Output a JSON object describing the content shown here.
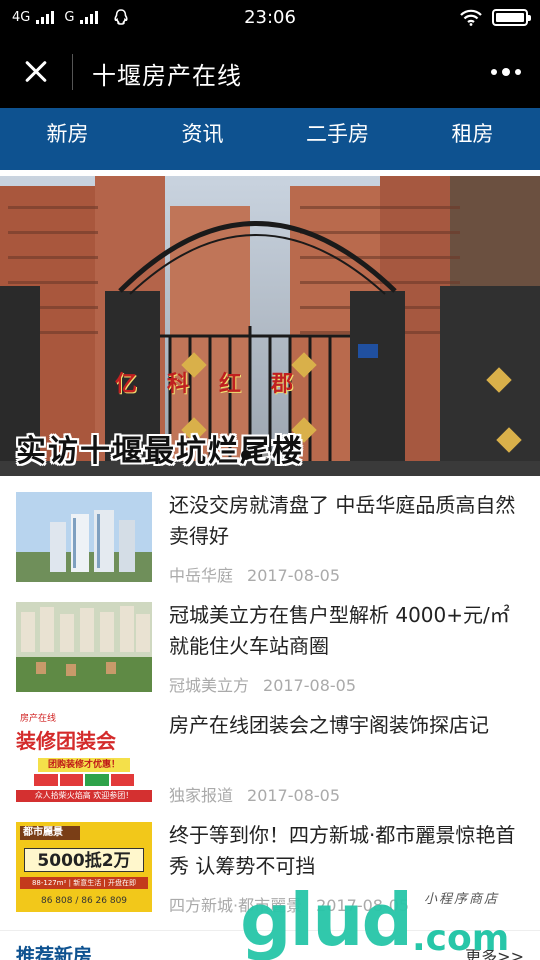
{
  "status_bar": {
    "carrier_1": "4G",
    "carrier_2": "G",
    "time": "23:06",
    "icons": [
      "signal-icon",
      "signal-icon",
      "qq-penguin-icon",
      "wifi-icon",
      "battery-icon"
    ]
  },
  "title_bar": {
    "title": "十堰房产在线",
    "close_icon": "close-icon",
    "more_icon": "more-icon"
  },
  "nav": {
    "items": [
      {
        "label": "新房"
      },
      {
        "label": "资讯"
      },
      {
        "label": "二手房"
      },
      {
        "label": "租房"
      }
    ],
    "color": "#0e5290"
  },
  "banner": {
    "caption": "实访十堰最坑烂尾楼",
    "arch_text": "亿科红郡",
    "slide_count": 2,
    "active_slide": 1
  },
  "news": [
    {
      "title": "还没交房就清盘了 中岳华庭品质高自然卖得好",
      "source": "中岳华庭",
      "date": "2017-08-05"
    },
    {
      "title": "冠城美立方在售户型解析 4000+元/㎡就能住火车站商圈",
      "source": "冠城美立方",
      "date": "2017-08-05"
    },
    {
      "title": "房产在线团装会之博宇阁装饰探店记",
      "source": "独家报道",
      "date": "2017-08-05"
    },
    {
      "title": "终于等到你！四方新城·都市麗景惊艳首秀 认筹势不可挡",
      "source": "四方新城·都市麗景",
      "date": "2017-08-05"
    }
  ],
  "thumb_texts": {
    "t3_brand": "房产在线",
    "t3_big": "装修团装会",
    "t3_small": "团购装修才优惠！",
    "t3_bottom": "众人拾柴火焰高 欢迎参团！",
    "t4_brand": "都市麗景",
    "t4_big": "5000抵2万",
    "t4_line": "88-127m² | 新意生活 | 开盘在即",
    "t4_phone": "86 808 / 86 26 809"
  },
  "section": {
    "title": "推荐新房",
    "more": "更多>>"
  },
  "watermark": {
    "main": "glud",
    "com": ".com",
    "sub": "小程序商店"
  }
}
